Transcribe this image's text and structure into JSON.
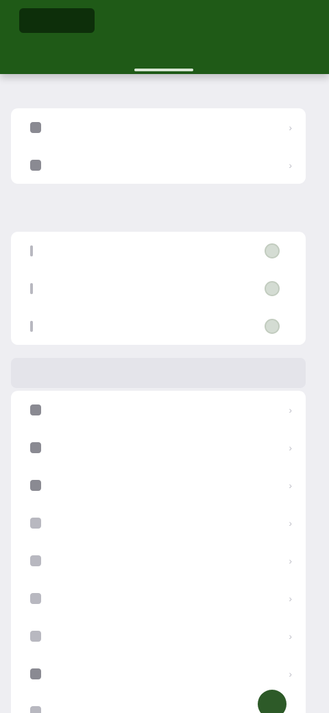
{
  "header": {
    "logo_icon": "app-logo-icon",
    "action_label": "",
    "tabs": [
      {
        "label": ""
      },
      {
        "label": ""
      }
    ],
    "color": "#1f5a17"
  },
  "sections": [
    {
      "label": "",
      "items": [
        {
          "label": "",
          "icon": "account-icon"
        },
        {
          "label": "",
          "icon": "info-icon"
        }
      ]
    },
    {
      "label": "",
      "items": [
        {
          "label": "",
          "icon": "bell-icon"
        },
        {
          "label": "",
          "icon": "mail-icon"
        },
        {
          "label": "",
          "icon": "phone-icon"
        }
      ]
    },
    {
      "label": "",
      "items": [
        {
          "label": "",
          "value": ""
        },
        {
          "label": "",
          "value": ""
        },
        {
          "label": "",
          "value": ""
        },
        {
          "label": "",
          "value": ""
        },
        {
          "label": "",
          "value": ""
        },
        {
          "label": "",
          "value": ""
        },
        {
          "label": "",
          "value": ""
        },
        {
          "label": "",
          "value": ""
        },
        {
          "label": "",
          "value": ""
        }
      ]
    }
  ],
  "accent_color": "#2d5a28"
}
